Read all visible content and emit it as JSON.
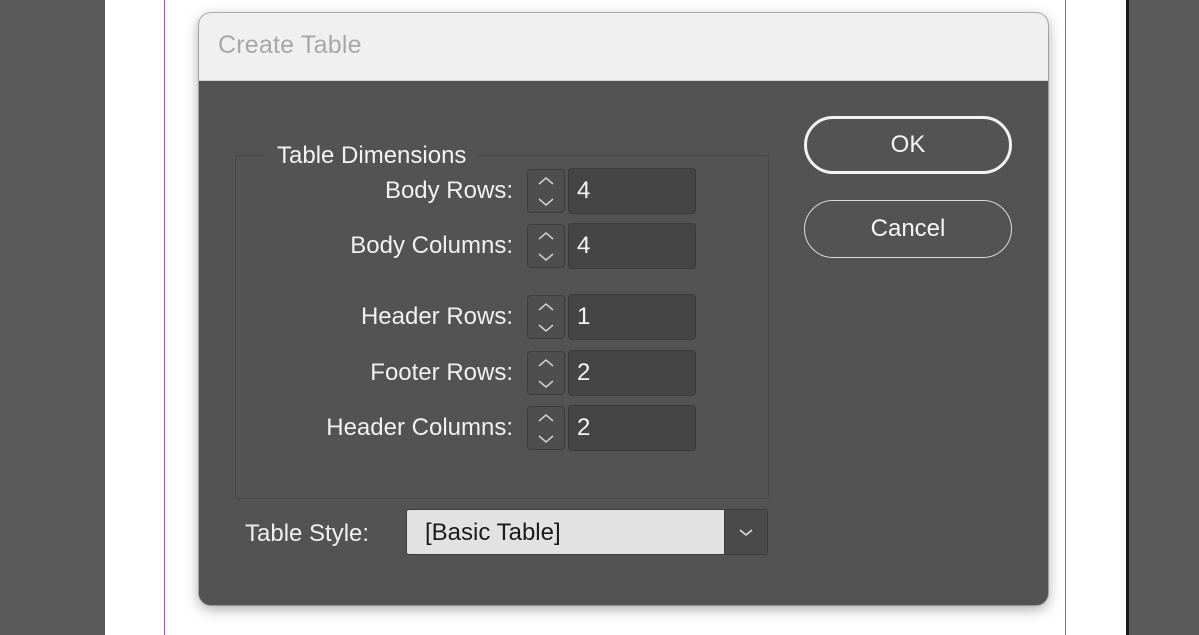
{
  "dialog": {
    "title": "Create Table",
    "group_title": "Table Dimensions",
    "fields": [
      {
        "label": "Body Rows:",
        "value": "4"
      },
      {
        "label": "Body Columns:",
        "value": "4"
      },
      {
        "label": "Header Rows:",
        "value": "1"
      },
      {
        "label": "Footer Rows:",
        "value": "2"
      },
      {
        "label": "Header Columns:",
        "value": "2"
      }
    ],
    "table_style": {
      "label": "Table Style:",
      "value": "[Basic Table]"
    },
    "buttons": {
      "ok": "OK",
      "cancel": "Cancel"
    }
  },
  "icons": {
    "stepper_up": "chevron-up-icon",
    "stepper_down": "chevron-down-icon",
    "dropdown": "chevron-down-icon"
  },
  "colors": {
    "dialog_body": "#535353",
    "titlebar": "#f0f0f0",
    "margin_guide": "#9b59c9"
  }
}
